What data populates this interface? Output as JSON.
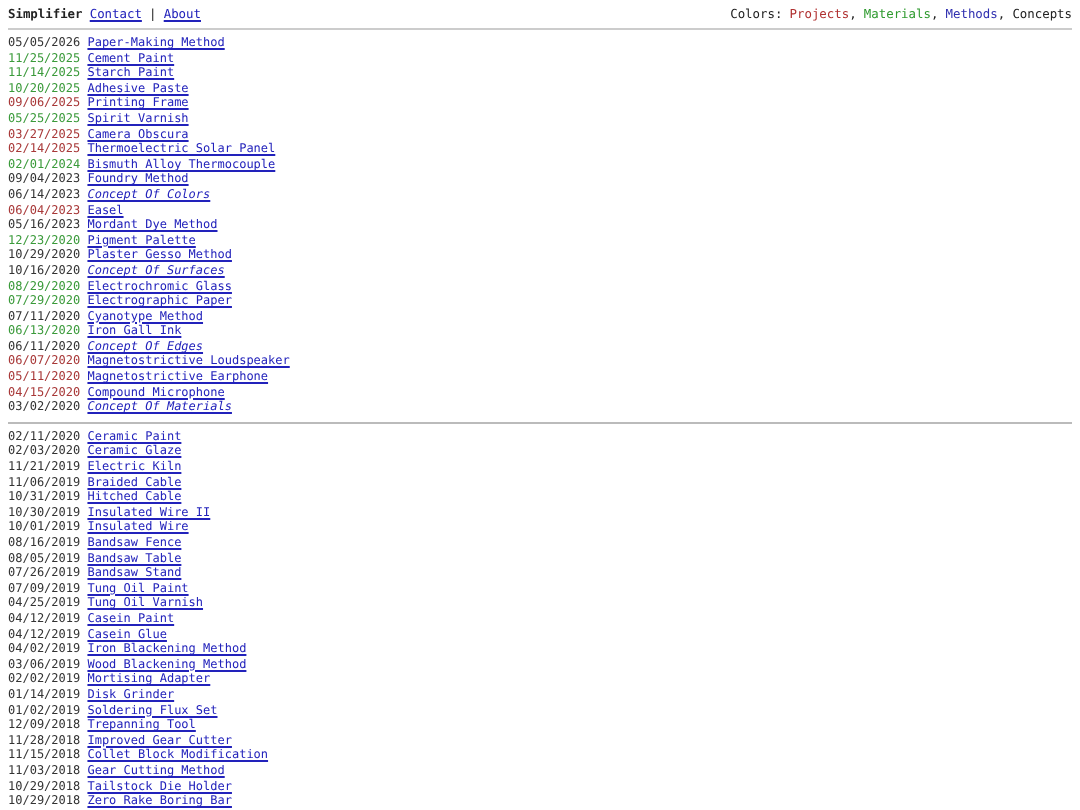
{
  "header": {
    "brand": "Simplifier",
    "links": [
      {
        "label": "Contact"
      },
      {
        "label": "About"
      }
    ],
    "separator": "|",
    "legend_label": "Colors:",
    "legend_separator": ",",
    "legend": [
      {
        "label": "Projects",
        "kind": "project"
      },
      {
        "label": "Materials",
        "kind": "material"
      },
      {
        "label": "Methods",
        "kind": "method"
      },
      {
        "label": "Concepts",
        "kind": "concept"
      }
    ]
  },
  "recent": [
    {
      "date": "05/05/2026",
      "title": "Paper-Making Method",
      "kind": "method"
    },
    {
      "date": "11/25/2025",
      "title": "Cement Paint",
      "kind": "material"
    },
    {
      "date": "11/14/2025",
      "title": "Starch Paint",
      "kind": "material"
    },
    {
      "date": "10/20/2025",
      "title": "Adhesive Paste",
      "kind": "material"
    },
    {
      "date": "09/06/2025",
      "title": "Printing Frame",
      "kind": "project"
    },
    {
      "date": "05/25/2025",
      "title": "Spirit Varnish",
      "kind": "material"
    },
    {
      "date": "03/27/2025",
      "title": "Camera Obscura",
      "kind": "project"
    },
    {
      "date": "02/14/2025",
      "title": "Thermoelectric Solar Panel",
      "kind": "project"
    },
    {
      "date": "02/01/2024",
      "title": "Bismuth Alloy Thermocouple",
      "kind": "material"
    },
    {
      "date": "09/04/2023",
      "title": "Foundry Method",
      "kind": "method"
    },
    {
      "date": "06/14/2023",
      "title": "Concept Of Colors",
      "kind": "concept"
    },
    {
      "date": "06/04/2023",
      "title": "Easel",
      "kind": "project"
    },
    {
      "date": "05/16/2023",
      "title": "Mordant Dye Method",
      "kind": "method"
    },
    {
      "date": "12/23/2020",
      "title": "Pigment Palette",
      "kind": "material"
    },
    {
      "date": "10/29/2020",
      "title": "Plaster Gesso Method",
      "kind": "method"
    },
    {
      "date": "10/16/2020",
      "title": "Concept Of Surfaces",
      "kind": "concept"
    },
    {
      "date": "08/29/2020",
      "title": "Electrochromic Glass",
      "kind": "material"
    },
    {
      "date": "07/29/2020",
      "title": "Electrographic Paper",
      "kind": "material"
    },
    {
      "date": "07/11/2020",
      "title": "Cyanotype Method",
      "kind": "method"
    },
    {
      "date": "06/13/2020",
      "title": "Iron Gall Ink",
      "kind": "material"
    },
    {
      "date": "06/11/2020",
      "title": "Concept Of Edges",
      "kind": "concept"
    },
    {
      "date": "06/07/2020",
      "title": "Magnetostrictive Loudspeaker",
      "kind": "project"
    },
    {
      "date": "05/11/2020",
      "title": "Magnetostrictive Earphone",
      "kind": "project"
    },
    {
      "date": "04/15/2020",
      "title": "Compound Microphone",
      "kind": "project"
    },
    {
      "date": "03/02/2020",
      "title": "Concept Of Materials",
      "kind": "concept"
    }
  ],
  "archive": [
    {
      "date": "02/11/2020",
      "title": "Ceramic Paint"
    },
    {
      "date": "02/03/2020",
      "title": "Ceramic Glaze"
    },
    {
      "date": "11/21/2019",
      "title": "Electric Kiln"
    },
    {
      "date": "11/06/2019",
      "title": "Braided Cable"
    },
    {
      "date": "10/31/2019",
      "title": "Hitched Cable"
    },
    {
      "date": "10/30/2019",
      "title": "Insulated Wire II"
    },
    {
      "date": "10/01/2019",
      "title": "Insulated Wire"
    },
    {
      "date": "08/16/2019",
      "title": "Bandsaw Fence"
    },
    {
      "date": "08/05/2019",
      "title": "Bandsaw Table"
    },
    {
      "date": "07/26/2019",
      "title": "Bandsaw Stand"
    },
    {
      "date": "07/09/2019",
      "title": "Tung Oil Paint"
    },
    {
      "date": "04/25/2019",
      "title": "Tung Oil Varnish"
    },
    {
      "date": "04/12/2019",
      "title": "Casein Paint"
    },
    {
      "date": "04/12/2019",
      "title": "Casein Glue"
    },
    {
      "date": "04/02/2019",
      "title": "Iron Blackening Method"
    },
    {
      "date": "03/06/2019",
      "title": "Wood Blackening Method"
    },
    {
      "date": "02/02/2019",
      "title": "Mortising Adapter"
    },
    {
      "date": "01/14/2019",
      "title": "Disk Grinder"
    },
    {
      "date": "01/02/2019",
      "title": "Soldering Flux Set"
    },
    {
      "date": "12/09/2018",
      "title": "Trepanning Tool"
    },
    {
      "date": "11/28/2018",
      "title": "Improved Gear Cutter"
    },
    {
      "date": "11/15/2018",
      "title": "Collet Block Modification"
    },
    {
      "date": "11/03/2018",
      "title": "Gear Cutting Method"
    },
    {
      "date": "10/29/2018",
      "title": "Tailstock Die Holder"
    },
    {
      "date": "10/29/2018",
      "title": "Zero Rake Boring Bar"
    }
  ]
}
